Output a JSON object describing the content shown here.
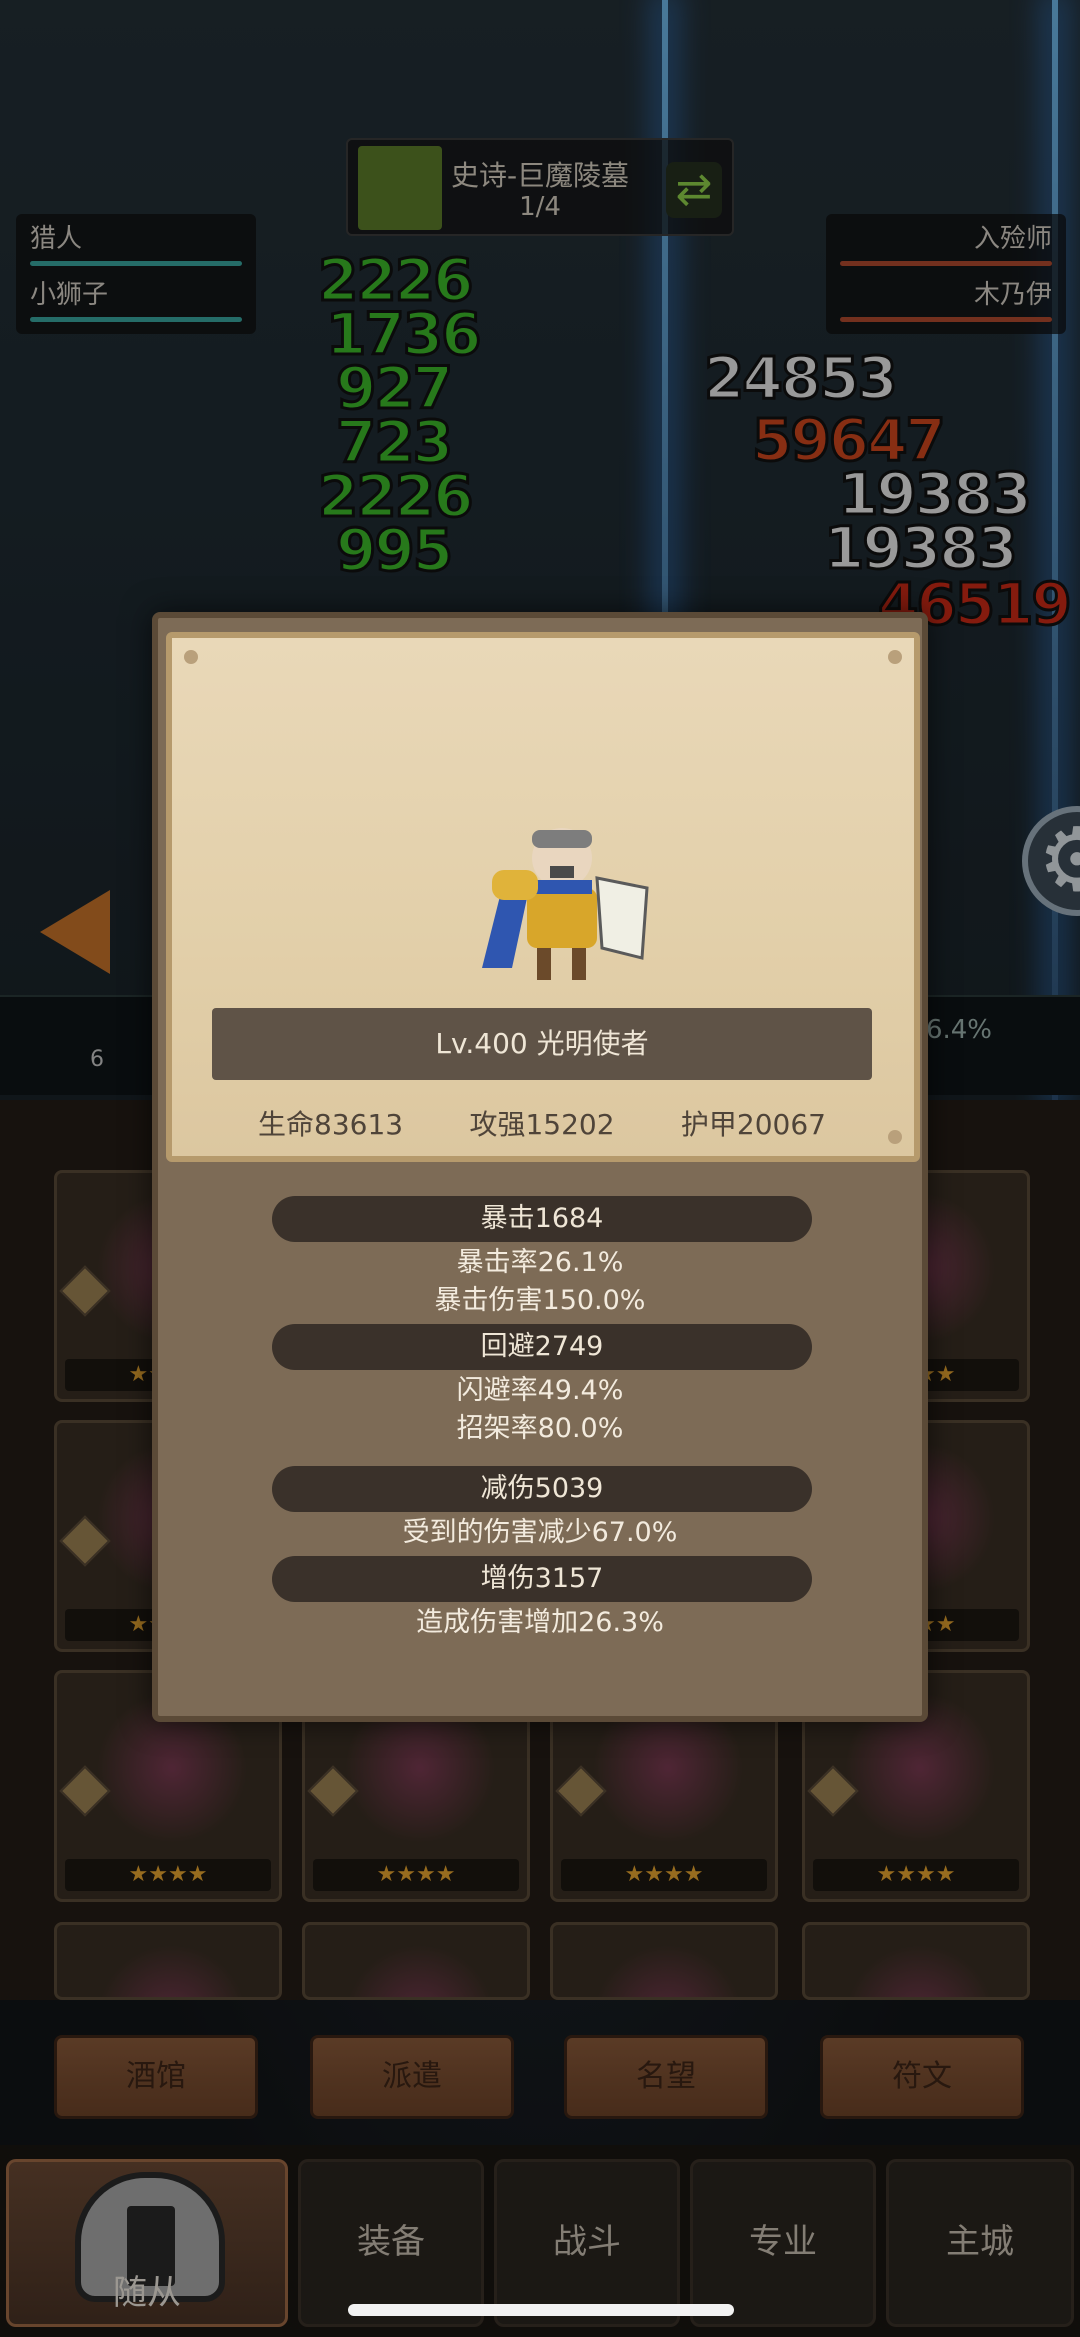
{
  "dungeon": {
    "title": "史诗-巨魔陵墓",
    "progress": "1/4",
    "swap_icon": "refresh-icon"
  },
  "team_left": {
    "members": [
      {
        "name": "猎人"
      },
      {
        "name": "小狮子"
      }
    ]
  },
  "team_right": {
    "members": [
      {
        "name": "入殓师"
      },
      {
        "name": "木乃伊"
      }
    ]
  },
  "damage_numbers": {
    "green": [
      "2226",
      "1736",
      "927",
      "723",
      "2226",
      "995"
    ],
    "right": [
      {
        "value": "24853",
        "color": "white"
      },
      {
        "value": "59647",
        "color": "orange"
      },
      {
        "value": "19383",
        "color": "white"
      },
      {
        "value": "19383",
        "color": "white"
      },
      {
        "value": "46519",
        "color": "red"
      }
    ]
  },
  "battle_strip": {
    "percent": "6.4%",
    "level": "6"
  },
  "roster": {
    "rows": [
      {
        "cards": [
          {
            "stars": "★★★★"
          },
          {
            "stars": "★★★★"
          },
          {
            "stars": "★★★★"
          },
          {
            "stars": "★★★★"
          }
        ]
      }
    ]
  },
  "roster_tabs": [
    "酒馆",
    "派遣",
    "名望",
    "符文"
  ],
  "bottom_nav": {
    "active": "随从",
    "items": [
      "装备",
      "战斗",
      "专业",
      "主城"
    ]
  },
  "hero": {
    "banner": "Lv.400 光明使者",
    "hp": "生命83613",
    "attack": "攻强15202",
    "armor": "护甲20067"
  },
  "stats": {
    "crit": "暴击1684",
    "crit_rate": "暴击率26.1%",
    "crit_damage": "暴击伤害150.0%",
    "evade": "回避2749",
    "dodge_rate": "闪避率49.4%",
    "parry_rate": "招架率80.0%",
    "reduce": "减伤5039",
    "reduce_desc": "受到的伤害减少67.0%",
    "boost": "增伤3157",
    "boost_desc": "造成伤害增加26.3%"
  },
  "colors": {
    "accent_green": "#3cbb2a",
    "damage_orange": "#d0471e",
    "parchment": "#e2cfa9",
    "popup_bg": "#7d6b56",
    "star": "#e8a630"
  }
}
